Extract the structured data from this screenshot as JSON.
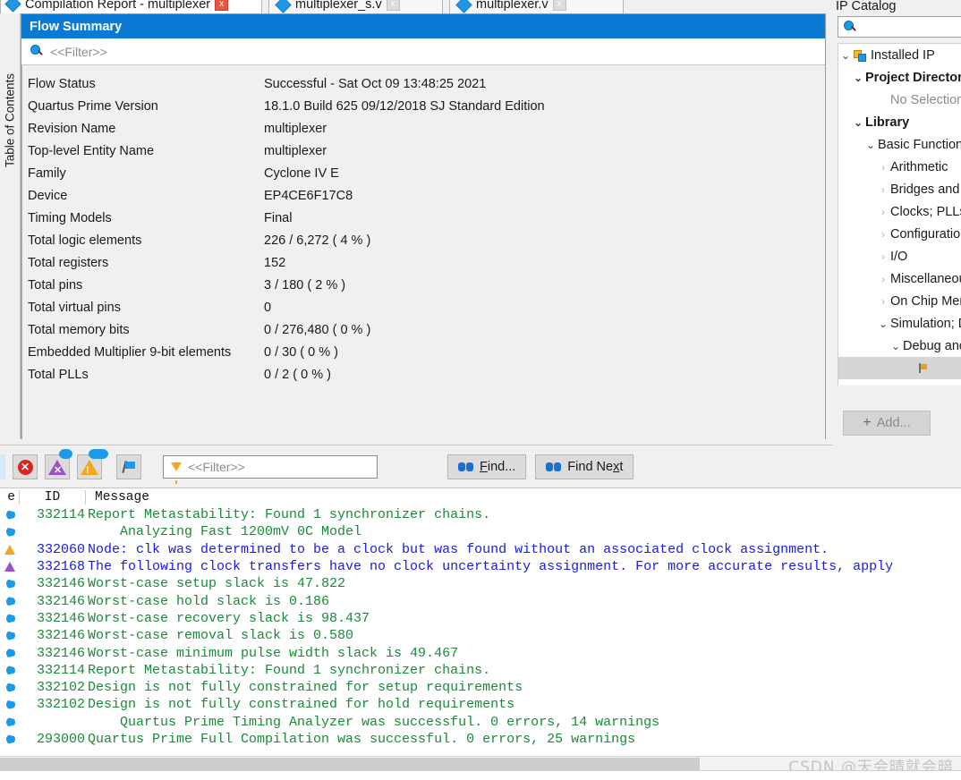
{
  "tabs": [
    {
      "label": "Compilation Report - multiplexer",
      "icon": "report-icon",
      "close": "x",
      "state": "active"
    },
    {
      "label": "multiplexer_s.v",
      "icon": "verilog-file-icon",
      "close": "x",
      "state": "inactive"
    },
    {
      "label": "multiplexer.v",
      "icon": "verilog-file-icon",
      "close": "x",
      "state": "inactive"
    }
  ],
  "toc": {
    "label": "Table of Contents"
  },
  "report": {
    "title": "Flow Summary",
    "filter_placeholder": "<<Filter>>",
    "search_icon": "search-icon",
    "rows": [
      {
        "key": "Flow Status",
        "value": "Successful - Sat Oct 09 13:48:25 2021"
      },
      {
        "key": "Quartus Prime Version",
        "value": "18.1.0 Build 625 09/12/2018 SJ Standard Edition"
      },
      {
        "key": "Revision Name",
        "value": "multiplexer"
      },
      {
        "key": "Top-level Entity Name",
        "value": "multiplexer"
      },
      {
        "key": "Family",
        "value": "Cyclone IV E"
      },
      {
        "key": "Device",
        "value": "EP4CE6F17C8"
      },
      {
        "key": "Timing Models",
        "value": "Final"
      },
      {
        "key": "Total logic elements",
        "value": "226 / 6,272 ( 4 % )"
      },
      {
        "key": "Total registers",
        "value": "152"
      },
      {
        "key": "Total pins",
        "value": "3 / 180 ( 2 % )"
      },
      {
        "key": "Total virtual pins",
        "value": "0"
      },
      {
        "key": "Total memory bits",
        "value": "0 / 276,480 ( 0 % )"
      },
      {
        "key": "Embedded Multiplier 9-bit elements",
        "value": "0 / 30 ( 0 % )"
      },
      {
        "key": "Total PLLs",
        "value": "0 / 2 ( 0 % )"
      }
    ]
  },
  "ip_catalog": {
    "title": "IP Catalog",
    "search_value": "",
    "search_icon": "search-icon",
    "nodes": [
      {
        "label": "Installed IP",
        "indent": 0,
        "chev": "expanded",
        "icon": "ip-block-icon",
        "style": "normal"
      },
      {
        "label": "Project Directory",
        "indent": 1,
        "chev": "expanded",
        "icon": "none",
        "style": "bold"
      },
      {
        "label": "No Selection",
        "indent": 3,
        "chev": "none",
        "icon": "none",
        "style": "muted"
      },
      {
        "label": "Library",
        "indent": 1,
        "chev": "expanded",
        "icon": "none",
        "style": "bold"
      },
      {
        "label": "Basic Functions",
        "indent": 2,
        "chev": "expanded",
        "icon": "none",
        "style": "normal"
      },
      {
        "label": "Arithmetic",
        "indent": 3,
        "chev": "collapsed",
        "icon": "none",
        "style": "normal"
      },
      {
        "label": "Bridges and Ada",
        "indent": 3,
        "chev": "collapsed",
        "icon": "none",
        "style": "normal"
      },
      {
        "label": "Clocks; PLLs and",
        "indent": 3,
        "chev": "collapsed",
        "icon": "none",
        "style": "normal"
      },
      {
        "label": "Configuration an",
        "indent": 3,
        "chev": "collapsed",
        "icon": "none",
        "style": "normal"
      },
      {
        "label": "I/O",
        "indent": 3,
        "chev": "collapsed",
        "icon": "none",
        "style": "normal"
      },
      {
        "label": "Miscellaneous",
        "indent": 3,
        "chev": "collapsed",
        "icon": "none",
        "style": "normal"
      },
      {
        "label": "On Chip Memory",
        "indent": 3,
        "chev": "collapsed",
        "icon": "none",
        "style": "normal"
      },
      {
        "label": "Simulation; Deb",
        "indent": 3,
        "chev": "expanded",
        "icon": "none",
        "style": "normal"
      },
      {
        "label": "Debug and Pe",
        "indent": 4,
        "chev": "expanded",
        "icon": "none",
        "style": "normal"
      },
      {
        "label": "",
        "indent": 5,
        "chev": "none",
        "icon": "flag-icon",
        "style": "selected"
      },
      {
        "label": "",
        "indent": 5,
        "chev": "none",
        "icon": "flag-icon",
        "style": "normal"
      },
      {
        "label": "",
        "indent": 5,
        "chev": "none",
        "icon": "flag-icon",
        "style": "normal"
      }
    ],
    "add_label": "Add...",
    "add_plus": "+"
  },
  "msg_toolbar": {
    "error_icon": "error-icon",
    "error_glyph": "✕",
    "critical_warning_icon": "critical-warning-icon",
    "critical_glyph": "✕",
    "warning_icon": "warning-icon",
    "warning_glyph": "!",
    "flag_icon": "flag-icon",
    "filter_placeholder": "<<Filter>>",
    "find_label": "Find...",
    "find_label_pre": "F",
    "find_label_post": "ind...",
    "find_next_pre": "Find Ne",
    "find_next_mid": "x",
    "find_next_post": "t",
    "find_next_label": "Find Next"
  },
  "messages": {
    "headers": {
      "type": "e",
      "id": "ID",
      "message": "Message"
    },
    "rows": [
      {
        "icon": "info",
        "id": "332114",
        "text": "Report Metastability: Found 1 synchronizer chains.",
        "level": "info"
      },
      {
        "icon": "info",
        "id": "",
        "text": "    Analyzing Fast 1200mV 0C Model",
        "level": "info"
      },
      {
        "icon": "warning",
        "id": "332060",
        "text": "Node: clk was determined to be a clock but was found without an associated clock assignment.",
        "level": "warn"
      },
      {
        "icon": "critical",
        "id": "332168",
        "text": "The following clock transfers have no clock uncertainty assignment. For more accurate results, apply",
        "level": "warn"
      },
      {
        "icon": "info",
        "id": "332146",
        "text": "Worst-case setup slack is 47.822",
        "level": "info"
      },
      {
        "icon": "info",
        "id": "332146",
        "text": "Worst-case hold slack is 0.186",
        "level": "info"
      },
      {
        "icon": "info",
        "id": "332146",
        "text": "Worst-case recovery slack is 98.437",
        "level": "info"
      },
      {
        "icon": "info",
        "id": "332146",
        "text": "Worst-case removal slack is 0.580",
        "level": "info"
      },
      {
        "icon": "info",
        "id": "332146",
        "text": "Worst-case minimum pulse width slack is 49.467",
        "level": "info"
      },
      {
        "icon": "info",
        "id": "332114",
        "text": "Report Metastability: Found 1 synchronizer chains.",
        "level": "info"
      },
      {
        "icon": "info",
        "id": "332102",
        "text": "Design is not fully constrained for setup requirements",
        "level": "info"
      },
      {
        "icon": "info",
        "id": "332102",
        "text": "Design is not fully constrained for hold requirements",
        "level": "info"
      },
      {
        "icon": "info",
        "id": "",
        "text": "    Quartus Prime Timing Analyzer was successful. 0 errors, 14 warnings",
        "level": "info"
      },
      {
        "icon": "info",
        "id": "293000",
        "text": "Quartus Prime Full Compilation was successful. 0 errors, 25 warnings",
        "level": "info"
      }
    ]
  },
  "watermark": {
    "text": "CSDN @天会晴就会暗"
  },
  "colors": {
    "title_blue": "#0a7ad4",
    "info_green": "#1a8a3a",
    "warn_blue": "#1a1ae0",
    "panel_grey": "#f0f0f0"
  }
}
